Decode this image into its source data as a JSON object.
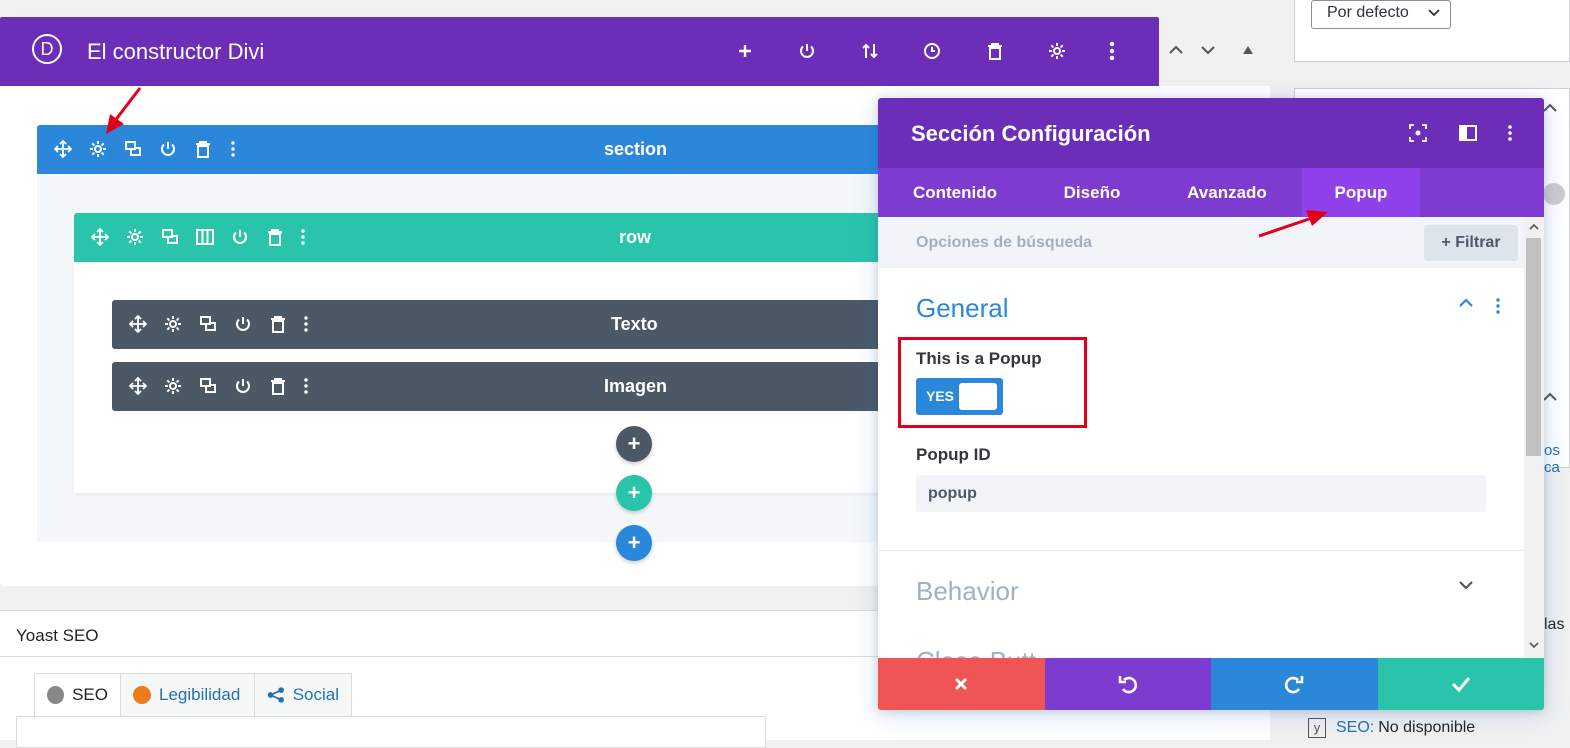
{
  "header": {
    "logo_letter": "D",
    "title": "El constructor Divi"
  },
  "builder": {
    "section_label": "section",
    "row_label": "row",
    "modules": [
      "Texto",
      "Imagen"
    ]
  },
  "modal": {
    "title": "Sección Configuración",
    "tabs": [
      {
        "label": "Contenido",
        "active": false
      },
      {
        "label": "Diseño",
        "active": false
      },
      {
        "label": "Avanzado",
        "active": false
      },
      {
        "label": "Popup",
        "active": true
      }
    ],
    "search_placeholder": "Opciones de búsqueda",
    "filter_label": "+ Filtrar",
    "general": {
      "title": "General",
      "popup_toggle_label": "This is a Popup",
      "popup_toggle_value": "YES",
      "popup_id_label": "Popup ID",
      "popup_id_value": "popup"
    },
    "behavior_title": "Behavior",
    "close_title": "Close Butt..."
  },
  "wp_side": {
    "default_select": "Por defecto",
    "cut_text_1": "os ca",
    "cut_text_2": "las",
    "seo_label": "SEO:",
    "seo_value": "No disponible"
  },
  "yoast": {
    "title": "Yoast SEO",
    "tabs": [
      "SEO",
      "Legibilidad",
      "Social"
    ]
  },
  "colors": {
    "divi_purple": "#6c2eb9",
    "section_blue": "#2b87da",
    "row_teal": "#29c4a9",
    "module_gray": "#4c5866",
    "discard_red": "#ef5555",
    "save_green": "#29c4a9",
    "highlight_red": "#e0001a"
  }
}
